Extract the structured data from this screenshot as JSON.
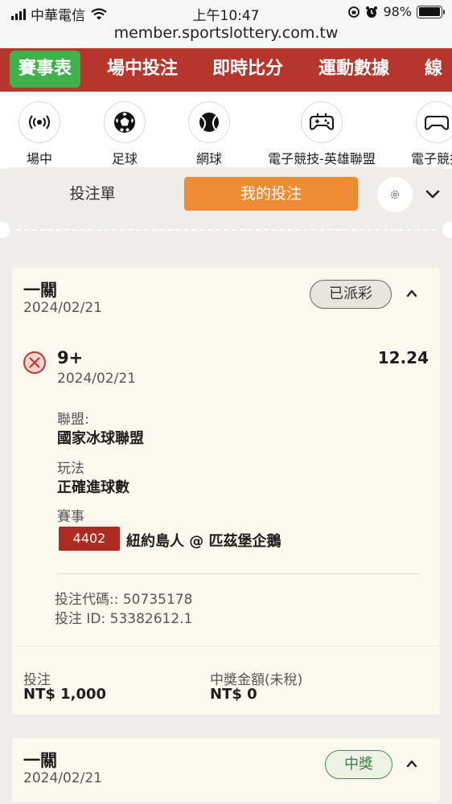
{
  "status_bar": {
    "carrier": "中華電信",
    "time": "上午10:47",
    "battery": "98%",
    "battery_level": 0.98
  },
  "url": "member.sportslottery.com.tw",
  "top_nav": {
    "tabs": [
      "賽事表",
      "場中投注",
      "即時比分",
      "運動數據",
      "線"
    ],
    "active_index": 0
  },
  "sports": [
    {
      "label": "場中",
      "icon": "live-icon"
    },
    {
      "label": "足球",
      "icon": "soccer-ball-icon"
    },
    {
      "label": "網球",
      "icon": "tennis-ball-icon"
    },
    {
      "label": "電子競技-英雄聯盟",
      "icon": "gamepad-icon"
    },
    {
      "label": "電子競技",
      "icon": "gamepad-icon"
    }
  ],
  "panel": {
    "tab_betslip": "投注單",
    "tab_mybets": "我的投注"
  },
  "bets": [
    {
      "type": "一關",
      "date": "2024/02/21",
      "status": "已派彩",
      "selection": "9+",
      "selection_date": "2024/02/21",
      "odds": "12.24",
      "league_label": "聯盟:",
      "league": "國家冰球聯盟",
      "market_label": "玩法",
      "market": "正確進球數",
      "event_label": "賽事",
      "event_id": "4402",
      "event": "紐約島人 @ 匹茲堡企鵝",
      "bet_code": "投注代碼:: 50735178",
      "bet_id": "投注 ID: 53382612.1",
      "stake_label": "投注",
      "stake": "NT$ 1,000",
      "payout_label": "中獎金額(未稅)",
      "payout": "NT$ 0"
    },
    {
      "type": "一關",
      "date": "2024/02/21",
      "status": "中獎"
    }
  ],
  "colors": {
    "nav_red": "#b7362b",
    "active_green": "#3fb24b",
    "orange_tab": "#ed8c35",
    "event_badge": "#ad2a22",
    "lost_icon": "#c0392b",
    "win_green": "#4f8b51"
  }
}
